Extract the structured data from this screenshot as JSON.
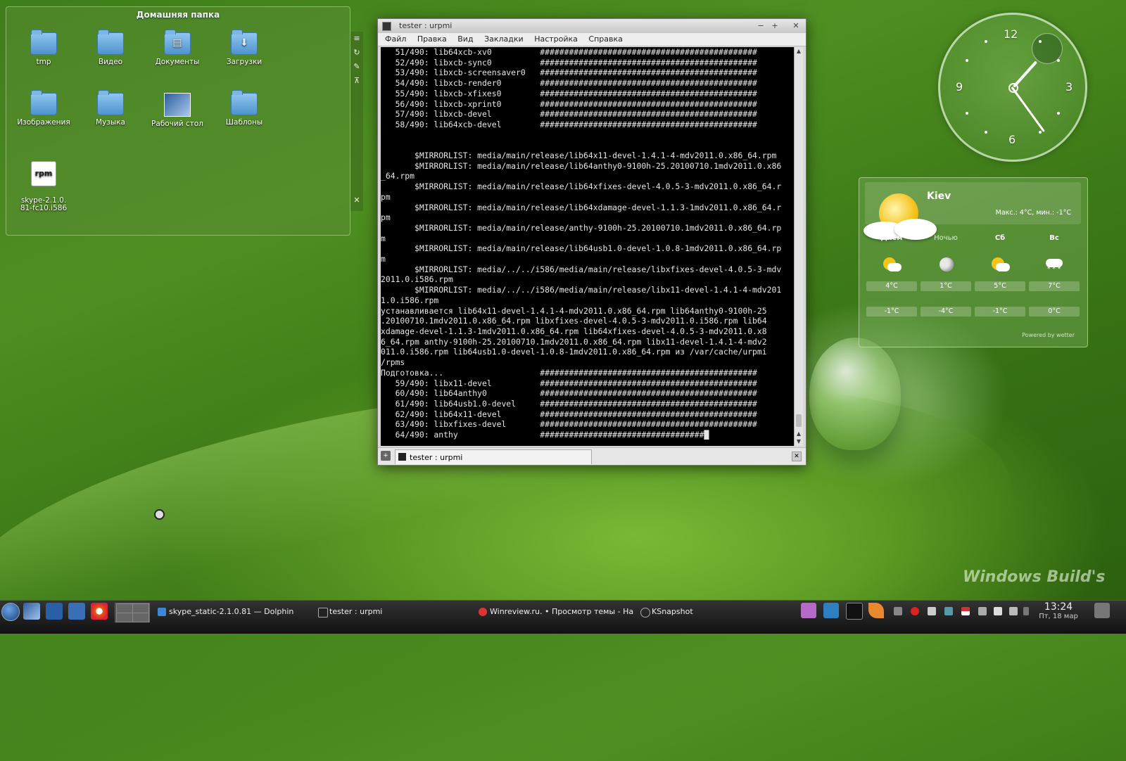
{
  "desktop": {
    "folderview": {
      "title": "Домашняя папка",
      "items": [
        {
          "label": "tmp",
          "icon": "folder-icon"
        },
        {
          "label": "Видео",
          "icon": "folder-icon"
        },
        {
          "label": "Документы",
          "icon": "folder-documents-icon"
        },
        {
          "label": "Загрузки",
          "icon": "folder-downloads-icon"
        },
        {
          "label": "Изображения",
          "icon": "folder-icon"
        },
        {
          "label": "Музыка",
          "icon": "folder-icon"
        },
        {
          "label": "Рабочий стол",
          "icon": "desktop-icon"
        },
        {
          "label": "Шаблоны",
          "icon": "folder-icon"
        },
        {
          "label": "skype-2.1.0.\n81-fc10.i586",
          "icon": "rpm-icon",
          "icon_text": "rpm"
        }
      ]
    },
    "watermark": "Windows Build's"
  },
  "terminal": {
    "title": "tester : urpmi",
    "menu": [
      "Файл",
      "Правка",
      "Вид",
      "Закладки",
      "Настройка",
      "Справка"
    ],
    "lines": [
      "   51/490: lib64xcb-xv0          #############################################",
      "   52/490: libxcb-sync0          #############################################",
      "   53/490: libxcb-screensaver0   #############################################",
      "   54/490: libxcb-render0        #############################################",
      "   55/490: libxcb-xfixes0        #############################################",
      "   56/490: libxcb-xprint0        #############################################",
      "   57/490: libxcb-devel          #############################################",
      "   58/490: lib64xcb-devel        #############################################",
      "",
      "",
      "       $MIRRORLIST: media/main/release/lib64x11-devel-1.4.1-4-mdv2011.0.x86_64.rpm",
      "       $MIRRORLIST: media/main/release/lib64anthy0-9100h-25.20100710.1mdv2011.0.x86",
      "_64.rpm",
      "       $MIRRORLIST: media/main/release/lib64xfixes-devel-4.0.5-3-mdv2011.0.x86_64.r",
      "pm",
      "       $MIRRORLIST: media/main/release/lib64xdamage-devel-1.1.3-1mdv2011.0.x86_64.r",
      "pm",
      "       $MIRRORLIST: media/main/release/anthy-9100h-25.20100710.1mdv2011.0.x86_64.rp",
      "m",
      "       $MIRRORLIST: media/main/release/lib64usb1.0-devel-1.0.8-1mdv2011.0.x86_64.rp",
      "m",
      "       $MIRRORLIST: media/../../i586/media/main/release/libxfixes-devel-4.0.5-3-mdv",
      "2011.0.i586.rpm",
      "       $MIRRORLIST: media/../../i586/media/main/release/libx11-devel-1.4.1-4-mdv201",
      "1.0.i586.rpm",
      "устанавливается lib64x11-devel-1.4.1-4-mdv2011.0.x86_64.rpm lib64anthy0-9100h-25",
      ".20100710.1mdv2011.0.x86_64.rpm libxfixes-devel-4.0.5-3-mdv2011.0.i586.rpm lib64",
      "xdamage-devel-1.1.3-1mdv2011.0.x86_64.rpm lib64xfixes-devel-4.0.5-3-mdv2011.0.x8",
      "6_64.rpm anthy-9100h-25.20100710.1mdv2011.0.x86_64.rpm libx11-devel-1.4.1-4-mdv2",
      "011.0.i586.rpm lib64usb1.0-devel-1.0.8-1mdv2011.0.x86_64.rpm из /var/cache/urpmi",
      "/rpms",
      "Подготовка...                    #############################################",
      "   59/490: libx11-devel          #############################################",
      "   60/490: lib64anthy0           #############################################",
      "   61/490: lib64usb1.0-devel     #############################################",
      "   62/490: lib64x11-devel        #############################################",
      "   63/490: libxfixes-devel       #############################################",
      "   64/490: anthy                 ##################################█"
    ],
    "tab_label": "tester : urpmi"
  },
  "clock_widget": {
    "numerals": [
      "12",
      "3",
      "6",
      "9"
    ],
    "time": {
      "hours": 13,
      "minutes": 24
    }
  },
  "weather": {
    "city": "Kiev",
    "minmax": "Макс.: 4°C, мин.: -1°C",
    "columns": [
      {
        "day": "Днем",
        "icon": "partly-sunny-icon",
        "high": "4°C",
        "low": "-1°C"
      },
      {
        "day": "Ночью",
        "icon": "moon-icon",
        "high": "1°C",
        "low": "-4°C"
      },
      {
        "day": "Сб",
        "icon": "partly-sunny-icon",
        "high": "5°C",
        "low": "-1°C"
      },
      {
        "day": "Вс",
        "icon": "snow-icon",
        "high": "7°C",
        "low": "0°C"
      }
    ],
    "powered": "Powered by wetter"
  },
  "taskbar": {
    "tasks": [
      {
        "label": "skype_static-2.1.0.81 — Dolphin"
      },
      {
        "label": "tester : urpmi"
      },
      {
        "label": "Winreview.ru. • Просмотр темы - На"
      },
      {
        "label": "KSnapshot"
      }
    ],
    "time": "13:24",
    "date": "Пт, 18 мар"
  },
  "colors": {
    "accent": "#3e86d8",
    "terminal_bg": "#000000",
    "terminal_fg": "#e6e6e6"
  }
}
